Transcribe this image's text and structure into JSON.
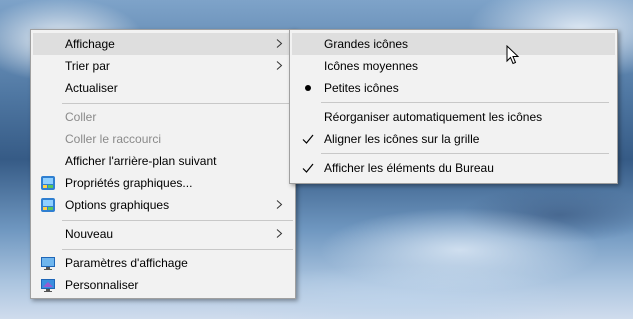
{
  "main_menu": {
    "items": [
      {
        "label": "Affichage",
        "submenu": true
      },
      {
        "label": "Trier par",
        "submenu": true
      },
      {
        "label": "Actualiser"
      },
      {
        "label": "Coller",
        "disabled": true
      },
      {
        "label": "Coller le raccourci",
        "disabled": true
      },
      {
        "label": "Afficher l'arrière-plan suivant"
      },
      {
        "label": "Propriétés graphiques...",
        "icon": "graphics-properties-icon"
      },
      {
        "label": "Options graphiques",
        "icon": "graphics-options-icon",
        "submenu": true
      },
      {
        "label": "Nouveau",
        "submenu": true
      },
      {
        "label": "Paramètres d'affichage",
        "icon": "display-settings-icon"
      },
      {
        "label": "Personnaliser",
        "icon": "personalize-icon"
      }
    ]
  },
  "sub_menu": {
    "items": [
      {
        "label": "Grandes icônes",
        "highlighted": true
      },
      {
        "label": "Icônes moyennes"
      },
      {
        "label": "Petites icônes",
        "mark": "bullet"
      },
      {
        "label": "Réorganiser automatiquement les icônes"
      },
      {
        "label": "Aligner les icônes sur la grille",
        "mark": "check"
      },
      {
        "label": "Afficher les éléments du Bureau",
        "mark": "check"
      }
    ]
  },
  "colors": {
    "menu_bg": "#f2f2f2",
    "highlight": "#dedede",
    "disabled_text": "#8a8a8a"
  }
}
